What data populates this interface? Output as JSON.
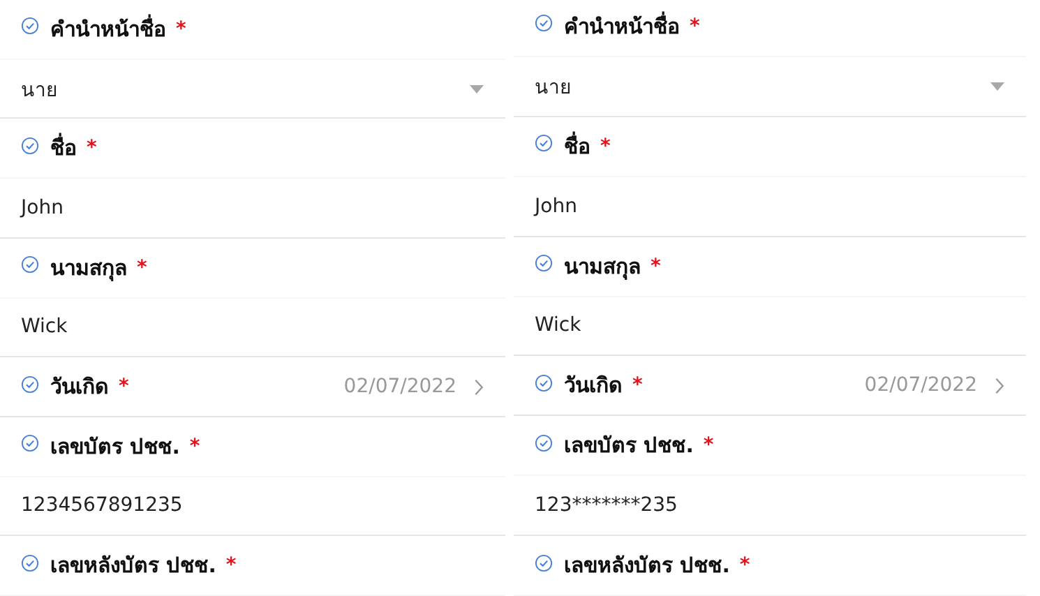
{
  "panels": [
    {
      "fields": [
        {
          "kind": "select",
          "label": "คำนำหน้าชื่อ",
          "required_mark": "*",
          "value": "นาย"
        },
        {
          "kind": "text",
          "label": "ชื่อ",
          "required_mark": "*",
          "value": "John"
        },
        {
          "kind": "text",
          "label": "นามสกุล",
          "required_mark": "*",
          "value": "Wick"
        },
        {
          "kind": "date",
          "label": "วันเกิด",
          "required_mark": "*",
          "value": "02/07/2022"
        },
        {
          "kind": "text",
          "label": "เลขบัตร ปชช.",
          "required_mark": "*",
          "value": "1234567891235"
        },
        {
          "kind": "label",
          "label": "เลขหลังบัตร ปชช.",
          "required_mark": "*"
        }
      ]
    },
    {
      "fields": [
        {
          "kind": "select",
          "label": "คำนำหน้าชื่อ",
          "required_mark": "*",
          "value": "นาย"
        },
        {
          "kind": "text",
          "label": "ชื่อ",
          "required_mark": "*",
          "value": "John"
        },
        {
          "kind": "text",
          "label": "นามสกุล",
          "required_mark": "*",
          "value": "Wick"
        },
        {
          "kind": "date",
          "label": "วันเกิด",
          "required_mark": "*",
          "value": "02/07/2022"
        },
        {
          "kind": "text",
          "label": "เลขบัตร ปชช.",
          "required_mark": "*",
          "value": "123*******235"
        },
        {
          "kind": "label",
          "label": "เลขหลังบัตร ปชช.",
          "required_mark": "*"
        }
      ]
    }
  ]
}
